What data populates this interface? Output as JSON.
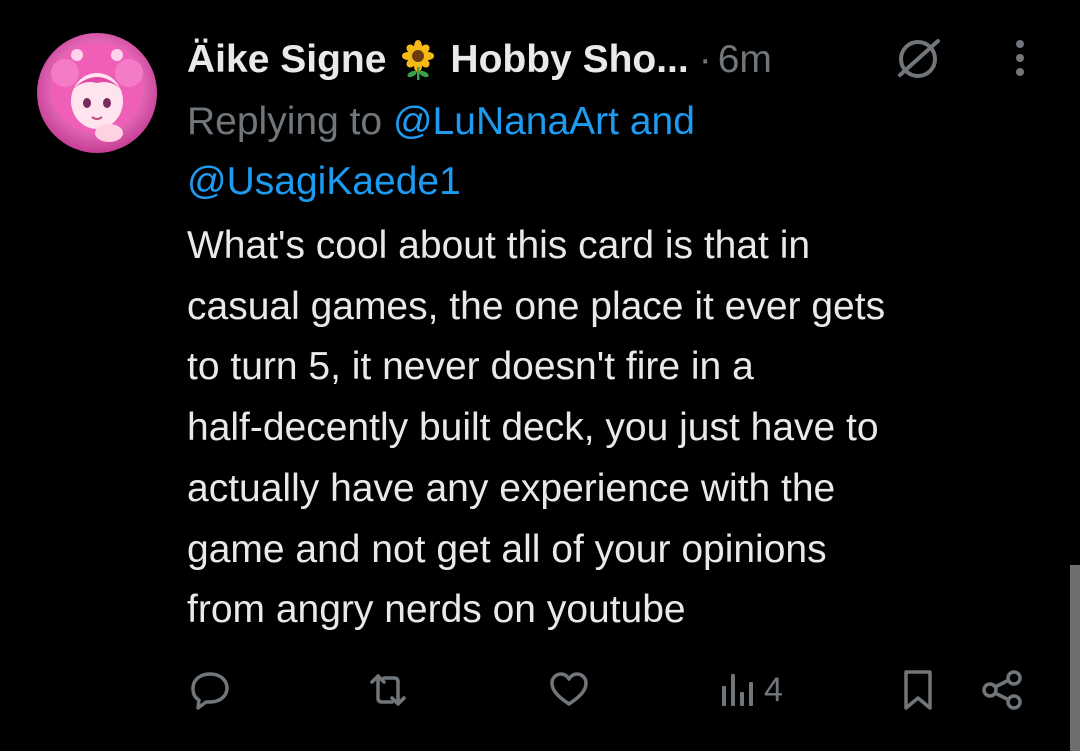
{
  "author": {
    "display_name": "Äike Signe",
    "emoji_name": "sunflower-emoji",
    "name_suffix": "Hobby Sho...",
    "time_separator": "·",
    "time_ago": "6m"
  },
  "reply": {
    "prefix": "Replying to",
    "mention_1": "@LuNanaArt",
    "conjunction": "and",
    "mention_2": "@UsagiKaede1"
  },
  "body": "What's cool about this card is that in\ncasual games, the one place it ever gets\nto turn 5, it never doesn't fire in a\nhalf-decently built deck, you just have to\nactually have any experience with the\ngame and not get all of your opinions\nfrom angry nerds on youtube",
  "actions": {
    "reply_icon": "reply-icon",
    "repost_icon": "repost-icon",
    "like_icon": "like-icon",
    "views_icon": "views-icon",
    "views_count": "4",
    "bookmark_icon": "bookmark-icon",
    "share_icon": "share-icon"
  },
  "colors": {
    "background": "#000000",
    "text": "#e7e9ea",
    "muted": "#71767b",
    "link": "#1d9bf0"
  }
}
